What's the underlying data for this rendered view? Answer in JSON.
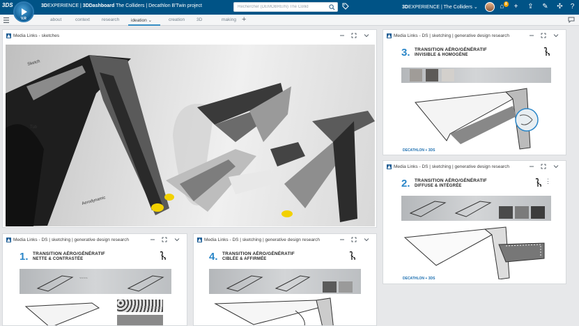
{
  "app": {
    "brand": "3D",
    "title_prefix": "EXPERIENCE | ",
    "title_app": "3DDashboard",
    "title_rest": " The Colliders | Decathlon B'Twin project",
    "version": "V.R",
    "search_placeholder": "Rechercher (DEMOBREIN) The Collid",
    "brand_right_bold": "3D",
    "brand_right": "EXPERIENCE | The Colliders",
    "notification_count": "8"
  },
  "tabs": [
    {
      "label": "about",
      "active": false
    },
    {
      "label": "context",
      "active": false
    },
    {
      "label": "research",
      "active": false
    },
    {
      "label": "ideation",
      "active": true
    },
    {
      "label": "creation",
      "active": false
    },
    {
      "label": "3D",
      "active": false
    },
    {
      "label": "making",
      "active": false
    }
  ],
  "widgets": {
    "sketches": {
      "title": "Media Links - sketches"
    },
    "w3": {
      "title": "Media Links - DS | sketching | generative design research"
    },
    "w2": {
      "title": "Media Links - DS | sketching | generative design research"
    },
    "w1": {
      "title": "Media Links - DS | sketching | generative design research"
    },
    "w4": {
      "title": "Media Links - DS | sketching | generative design research"
    }
  },
  "docs": {
    "d3": {
      "num": "3.",
      "line1": "TRANSITION AÉRO/GÉNÉRATIF",
      "line2": "INVISIBLE & HOMOGÈNE"
    },
    "d2": {
      "num": "2.",
      "line1": "TRANSITION AÉRO/GÉNÉRATIF",
      "line2": "DIFFUSE & INTÉGRÉE"
    },
    "d1": {
      "num": "1.",
      "line1": "TRANSITION AÉRO/GÉNÉRATIF",
      "line2": "NETTE & CONTRASTÉE"
    },
    "d4": {
      "num": "4.",
      "line1": "TRANSITION AÉRO/GÉNÉRATIF",
      "line2": "CIBLÉE & AFFIRMÉE"
    },
    "footer": "DECATHLON + 3DS"
  },
  "colors": {
    "topbar": "#005386",
    "accent": "#368ec4",
    "number": "#2a86c8"
  },
  "icons": [
    "compass-icon",
    "search-icon",
    "tag-icon",
    "home-icon",
    "add-icon",
    "share-icon",
    "tools-icon",
    "help-icon",
    "expand-icon",
    "chevron-down-icon",
    "menu-icon",
    "chat-icon"
  ]
}
